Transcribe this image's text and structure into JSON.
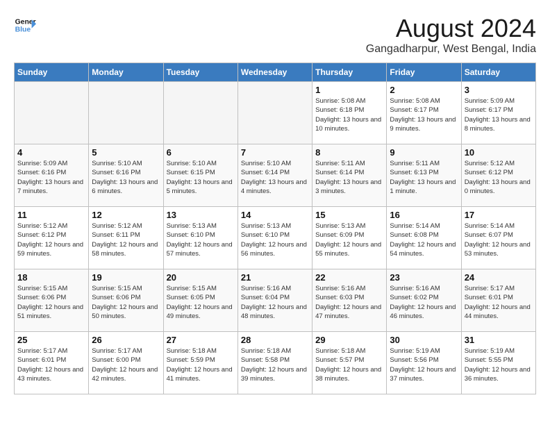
{
  "logo": {
    "line1": "General",
    "line2": "Blue"
  },
  "title": "August 2024",
  "subtitle": "Gangadharpur, West Bengal, India",
  "days_of_week": [
    "Sunday",
    "Monday",
    "Tuesday",
    "Wednesday",
    "Thursday",
    "Friday",
    "Saturday"
  ],
  "weeks": [
    [
      {
        "day": "",
        "empty": true
      },
      {
        "day": "",
        "empty": true
      },
      {
        "day": "",
        "empty": true
      },
      {
        "day": "",
        "empty": true
      },
      {
        "day": "1",
        "sunrise": "5:08 AM",
        "sunset": "6:18 PM",
        "daylight": "13 hours and 10 minutes."
      },
      {
        "day": "2",
        "sunrise": "5:08 AM",
        "sunset": "6:17 PM",
        "daylight": "13 hours and 9 minutes."
      },
      {
        "day": "3",
        "sunrise": "5:09 AM",
        "sunset": "6:17 PM",
        "daylight": "13 hours and 8 minutes."
      }
    ],
    [
      {
        "day": "4",
        "sunrise": "5:09 AM",
        "sunset": "6:16 PM",
        "daylight": "13 hours and 7 minutes."
      },
      {
        "day": "5",
        "sunrise": "5:10 AM",
        "sunset": "6:16 PM",
        "daylight": "13 hours and 6 minutes."
      },
      {
        "day": "6",
        "sunrise": "5:10 AM",
        "sunset": "6:15 PM",
        "daylight": "13 hours and 5 minutes."
      },
      {
        "day": "7",
        "sunrise": "5:10 AM",
        "sunset": "6:14 PM",
        "daylight": "13 hours and 4 minutes."
      },
      {
        "day": "8",
        "sunrise": "5:11 AM",
        "sunset": "6:14 PM",
        "daylight": "13 hours and 3 minutes."
      },
      {
        "day": "9",
        "sunrise": "5:11 AM",
        "sunset": "6:13 PM",
        "daylight": "13 hours and 1 minute."
      },
      {
        "day": "10",
        "sunrise": "5:12 AM",
        "sunset": "6:12 PM",
        "daylight": "13 hours and 0 minutes."
      }
    ],
    [
      {
        "day": "11",
        "sunrise": "5:12 AM",
        "sunset": "6:12 PM",
        "daylight": "12 hours and 59 minutes."
      },
      {
        "day": "12",
        "sunrise": "5:12 AM",
        "sunset": "6:11 PM",
        "daylight": "12 hours and 58 minutes."
      },
      {
        "day": "13",
        "sunrise": "5:13 AM",
        "sunset": "6:10 PM",
        "daylight": "12 hours and 57 minutes."
      },
      {
        "day": "14",
        "sunrise": "5:13 AM",
        "sunset": "6:10 PM",
        "daylight": "12 hours and 56 minutes."
      },
      {
        "day": "15",
        "sunrise": "5:13 AM",
        "sunset": "6:09 PM",
        "daylight": "12 hours and 55 minutes."
      },
      {
        "day": "16",
        "sunrise": "5:14 AM",
        "sunset": "6:08 PM",
        "daylight": "12 hours and 54 minutes."
      },
      {
        "day": "17",
        "sunrise": "5:14 AM",
        "sunset": "6:07 PM",
        "daylight": "12 hours and 53 minutes."
      }
    ],
    [
      {
        "day": "18",
        "sunrise": "5:15 AM",
        "sunset": "6:06 PM",
        "daylight": "12 hours and 51 minutes."
      },
      {
        "day": "19",
        "sunrise": "5:15 AM",
        "sunset": "6:06 PM",
        "daylight": "12 hours and 50 minutes."
      },
      {
        "day": "20",
        "sunrise": "5:15 AM",
        "sunset": "6:05 PM",
        "daylight": "12 hours and 49 minutes."
      },
      {
        "day": "21",
        "sunrise": "5:16 AM",
        "sunset": "6:04 PM",
        "daylight": "12 hours and 48 minutes."
      },
      {
        "day": "22",
        "sunrise": "5:16 AM",
        "sunset": "6:03 PM",
        "daylight": "12 hours and 47 minutes."
      },
      {
        "day": "23",
        "sunrise": "5:16 AM",
        "sunset": "6:02 PM",
        "daylight": "12 hours and 46 minutes."
      },
      {
        "day": "24",
        "sunrise": "5:17 AM",
        "sunset": "6:01 PM",
        "daylight": "12 hours and 44 minutes."
      }
    ],
    [
      {
        "day": "25",
        "sunrise": "5:17 AM",
        "sunset": "6:01 PM",
        "daylight": "12 hours and 43 minutes."
      },
      {
        "day": "26",
        "sunrise": "5:17 AM",
        "sunset": "6:00 PM",
        "daylight": "12 hours and 42 minutes."
      },
      {
        "day": "27",
        "sunrise": "5:18 AM",
        "sunset": "5:59 PM",
        "daylight": "12 hours and 41 minutes."
      },
      {
        "day": "28",
        "sunrise": "5:18 AM",
        "sunset": "5:58 PM",
        "daylight": "12 hours and 39 minutes."
      },
      {
        "day": "29",
        "sunrise": "5:18 AM",
        "sunset": "5:57 PM",
        "daylight": "12 hours and 38 minutes."
      },
      {
        "day": "30",
        "sunrise": "5:19 AM",
        "sunset": "5:56 PM",
        "daylight": "12 hours and 37 minutes."
      },
      {
        "day": "31",
        "sunrise": "5:19 AM",
        "sunset": "5:55 PM",
        "daylight": "12 hours and 36 minutes."
      }
    ]
  ]
}
